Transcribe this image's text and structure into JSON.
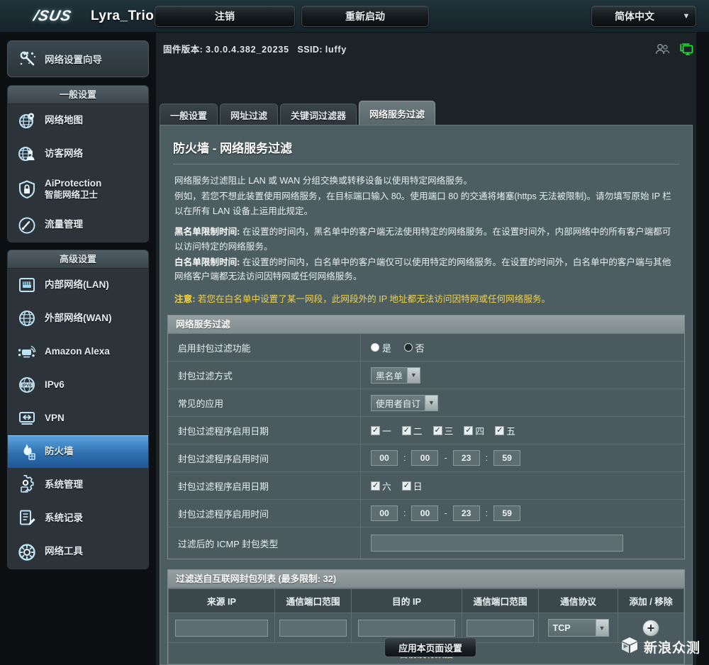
{
  "header": {
    "brand": "/SUS",
    "model": "Lyra_Trio",
    "logout_label": "注销",
    "reboot_label": "重新启动",
    "language": "简体中文",
    "caret_icon": "chevron-down-icon"
  },
  "status": {
    "firmware_label": "固件版本:",
    "firmware_value": "3.0.0.4.382_20235",
    "ssid_label": "SSID:",
    "ssid_value": "luffy",
    "clients_icon": "clients-icon",
    "network_icon": "network-map-icon",
    "network_icon_color": "#2ae03c"
  },
  "sidebar": {
    "wizard": {
      "label": "网络设置向导",
      "icon": "wizard-icon"
    },
    "groups": [
      {
        "title": "一般设置",
        "items": [
          {
            "label": "网络地图",
            "icon": "network-map-icon",
            "active": false
          },
          {
            "label": "访客网络",
            "icon": "guest-network-icon",
            "active": false
          },
          {
            "label": "AiProtection",
            "sub": "智能网络卫士",
            "icon": "shield-lock-icon",
            "active": false
          },
          {
            "label": "流量管理",
            "icon": "gauge-icon",
            "active": false
          }
        ]
      },
      {
        "title": "高级设置",
        "items": [
          {
            "label": "内部网络(LAN)",
            "icon": "lan-icon",
            "active": false
          },
          {
            "label": "外部网络(WAN)",
            "icon": "wan-globe-icon",
            "active": false
          },
          {
            "label": "Amazon Alexa",
            "icon": "alexa-icon",
            "active": false
          },
          {
            "label": "IPv6",
            "icon": "ipv6-icon",
            "active": false
          },
          {
            "label": "VPN",
            "icon": "vpn-icon",
            "active": false
          },
          {
            "label": "防火墙",
            "icon": "firewall-flame-icon",
            "active": true
          },
          {
            "label": "系统管理",
            "icon": "administration-gear-icon",
            "active": false
          },
          {
            "label": "系统记录",
            "icon": "system-log-icon",
            "active": false
          },
          {
            "label": "网络工具",
            "icon": "network-tools-icon",
            "active": false
          }
        ]
      }
    ]
  },
  "tabs": [
    {
      "label": "一般设置",
      "active": false
    },
    {
      "label": "网址过滤",
      "active": false
    },
    {
      "label": "关键词过滤器",
      "active": false
    },
    {
      "label": "网络服务过滤",
      "active": true
    }
  ],
  "main": {
    "title": "防火墙 - 网络服务过滤",
    "desc": [
      "网络服务过滤阻止 LAN 或 WAN 分组交换或转移设备以使用特定网络服务。",
      "例如，若您不想此装置使用网络服务，在目标端口输入 80。使用端口 80 的交通将堵塞(https 无法被限制)。请勿填写原始 IP 栏以在所有 LAN 设备上运用此规定。"
    ],
    "blacklist_term": "黑名单限制时间:",
    "blacklist_text": "在设置的时间内，黑名单中的客户端无法使用特定的网络服务。在设置时间外，内部网络中的所有客户端都可以访问特定的网络服务。",
    "whitelist_term": "白名单限制时间:",
    "whitelist_text": "在设置的时间内，白名单中的客户端仅可以使用特定的网络服务。在设置的时间外，白名单中的客户端与其他网络客户端都无法访问因特网或任何网络服务。",
    "note_term": "注意:",
    "note_text": "若您在白名单中设置了某一网段，此网段外的 IP 地址都无法访问因特网或任何网络服务。",
    "note_color": "#f2d24b"
  },
  "settings": {
    "section_title": "网络服务过滤",
    "enable": {
      "label": "启用封包过滤功能",
      "yes_label": "是",
      "no_label": "否",
      "selected": "是"
    },
    "filter_mode": {
      "label": "封包过滤方式",
      "value": "黑名单"
    },
    "well_known": {
      "label": "常见的应用",
      "value": "使用者自订"
    },
    "weekday_days": {
      "label": "封包过滤程序启用日期",
      "days": [
        {
          "label": "一",
          "checked": true
        },
        {
          "label": "二",
          "checked": true
        },
        {
          "label": "三",
          "checked": true
        },
        {
          "label": "四",
          "checked": true
        },
        {
          "label": "五",
          "checked": true
        }
      ]
    },
    "weekday_time": {
      "label": "封包过滤程序启用时间",
      "start_hour": "00",
      "start_min": "00",
      "end_hour": "23",
      "end_min": "59",
      "colon": ":",
      "dash": "-"
    },
    "weekend_days": {
      "label": "封包过滤程序启用日期",
      "days": [
        {
          "label": "六",
          "checked": true
        },
        {
          "label": "日",
          "checked": true
        }
      ]
    },
    "weekend_time": {
      "label": "封包过滤程序启用时间",
      "start_hour": "00",
      "start_min": "00",
      "end_hour": "23",
      "end_min": "59",
      "colon": ":",
      "dash": "-"
    },
    "icmp": {
      "label": "过滤后的 ICMP 封包类型",
      "value": "",
      "placeholder": ""
    }
  },
  "list": {
    "section_title": "过滤送自互联网封包列表 (最多限制:  32)",
    "columns": [
      "来源 IP",
      "通信端口范围",
      "目的 IP",
      "通信端口范围",
      "通信协议",
      "添加 / 移除"
    ],
    "new_row": {
      "source_ip": "",
      "source_port": "",
      "dest_ip": "",
      "dest_port": "",
      "protocol": "TCP",
      "add_icon": "plus-circle-icon"
    },
    "empty_text": "目前没有数据"
  },
  "footer": {
    "apply_label": "应用本页面设置",
    "watermark_text": "新浪众测",
    "watermark_icon": "cube-icon"
  }
}
